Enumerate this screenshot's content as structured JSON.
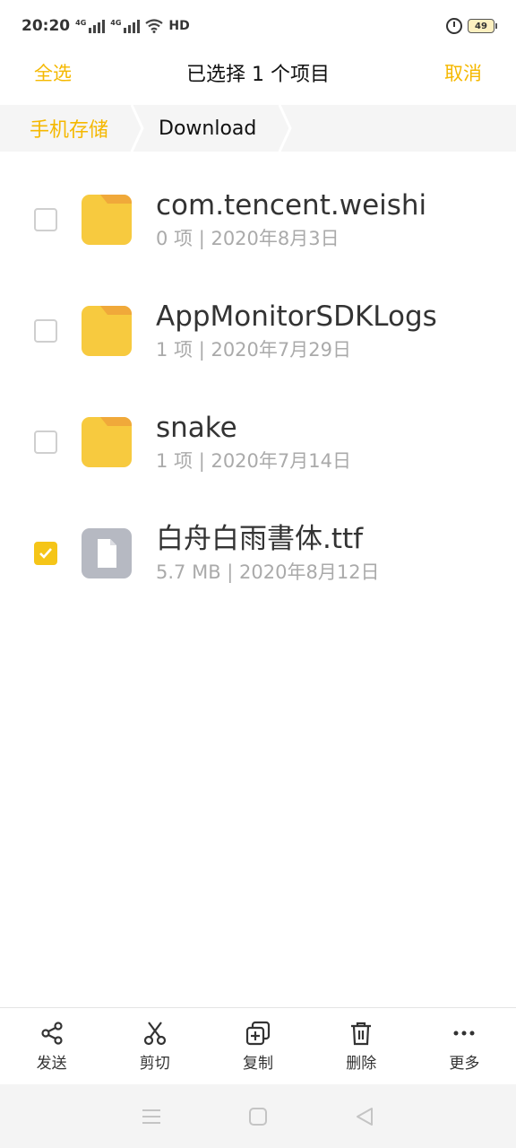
{
  "status_bar": {
    "time": "20:20",
    "network_1": "4G",
    "network_2": "4G",
    "hd": "HD",
    "battery": "49"
  },
  "header": {
    "select_all": "全选",
    "title": "已选择 1 个项目",
    "cancel": "取消"
  },
  "breadcrumb": {
    "root": "手机存储",
    "current": "Download"
  },
  "files": [
    {
      "name": "com.tencent.weishi",
      "meta": "0 项 | 2020年8月3日",
      "type": "folder",
      "checked": false
    },
    {
      "name": "AppMonitorSDKLogs",
      "meta": "1 项 | 2020年7月29日",
      "type": "folder",
      "checked": false
    },
    {
      "name": "snake",
      "meta": "1 项 | 2020年7月14日",
      "type": "folder",
      "checked": false
    },
    {
      "name": "白舟白雨書体.ttf",
      "meta": "5.7 MB | 2020年8月12日",
      "type": "file",
      "checked": true
    }
  ],
  "toolbar": {
    "send": "发送",
    "cut": "剪切",
    "copy": "复制",
    "delete": "删除",
    "more": "更多"
  },
  "colors": {
    "accent": "#f5b800",
    "folder": "#f7ca3f",
    "folder_tab": "#f0a93a",
    "file_icon": "#b6b9c2"
  }
}
